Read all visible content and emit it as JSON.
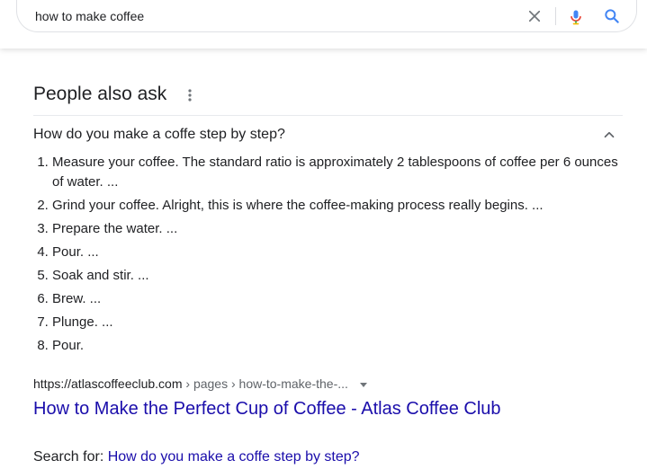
{
  "search": {
    "query": "how to make coffee"
  },
  "icons": {
    "clear": "close-icon",
    "mic": "mic-icon",
    "search": "search-icon",
    "more": "more-vert-icon",
    "collapse": "chevron-up-icon",
    "dropdown": "caret-down-icon"
  },
  "colors": {
    "link": "#1a0dab",
    "search_icon": "#4285f4",
    "text": "#202124",
    "muted": "#5f6368"
  },
  "paa": {
    "title": "People also ask",
    "question": "How do you make a coffe step by step?",
    "steps": [
      "Measure your coffee. The standard ratio is approximately 2 tablespoons of coffee per 6 ounces of water. ...",
      "Grind your coffee. Alright, this is where the coffee-making process really begins. ...",
      "Prepare the water. ...",
      "Pour. ...",
      "Soak and stir. ...",
      "Brew. ...",
      "Plunge. ...",
      "Pour."
    ],
    "source_url": "https://atlascoffeeclub.com",
    "source_path": " › pages › how-to-make-the-...",
    "result_title": "How to Make the Perfect Cup of Coffee - Atlas Coffee Club",
    "search_for_label": "Search for: ",
    "search_for_link": "How do you make a coffe step by step?"
  }
}
